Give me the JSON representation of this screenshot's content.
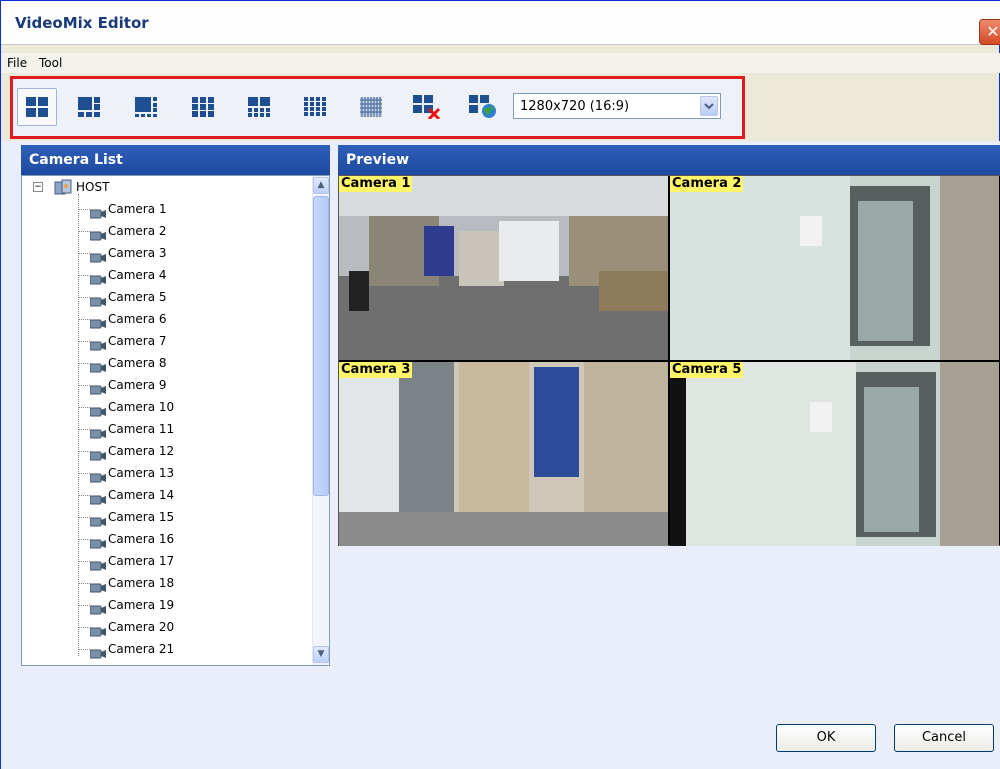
{
  "window": {
    "title": "VideoMix Editor",
    "close_glyph": "✕"
  },
  "menu": {
    "file": "File",
    "tool": "Tool"
  },
  "toolbar": {
    "layouts": [
      {
        "name": "layout-2x2-icon"
      },
      {
        "name": "layout-1plus5-icon"
      },
      {
        "name": "layout-1plus7-icon"
      },
      {
        "name": "layout-3x3-icon"
      },
      {
        "name": "layout-4x3-icon"
      },
      {
        "name": "layout-4x4-icon"
      },
      {
        "name": "layout-5x5-icon"
      },
      {
        "name": "layout-clear-icon"
      },
      {
        "name": "layout-web-icon"
      }
    ],
    "resolution": {
      "selected": "1280x720 (16:9)"
    }
  },
  "camera_list": {
    "header": "Camera List",
    "root": "HOST",
    "cameras": [
      "Camera 1",
      "Camera 2",
      "Camera 3",
      "Camera 4",
      "Camera 5",
      "Camera 6",
      "Camera 7",
      "Camera 8",
      "Camera 9",
      "Camera 10",
      "Camera 11",
      "Camera 12",
      "Camera 13",
      "Camera 14",
      "Camera 15",
      "Camera 16",
      "Camera 17",
      "Camera 18",
      "Camera 19",
      "Camera 20",
      "Camera 21"
    ]
  },
  "preview": {
    "header": "Preview",
    "tiles": [
      {
        "label": "Camera 1"
      },
      {
        "label": "Camera 2"
      },
      {
        "label": "Camera 3"
      },
      {
        "label": "Camera 5"
      }
    ]
  },
  "buttons": {
    "ok": "OK",
    "cancel": "Cancel"
  },
  "colors": {
    "panel_header": "#1d4aa0",
    "toolbar_highlight": "#e01b1b",
    "tile_label": "#fff568"
  }
}
